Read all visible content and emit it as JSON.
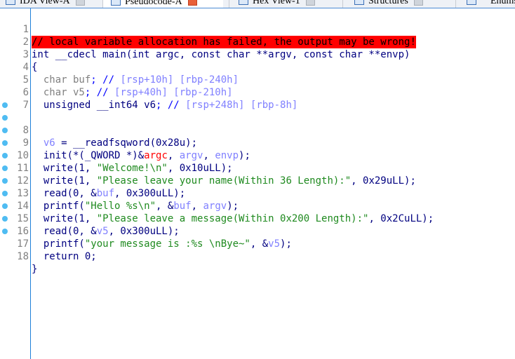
{
  "tabs": [
    {
      "label": "IDA View-A",
      "active": false
    },
    {
      "label": "Pseudocode-A",
      "active": true
    },
    {
      "label": "Hex View-1",
      "active": false
    },
    {
      "label": "Structures",
      "active": false
    },
    {
      "label": "Enums",
      "active": false
    }
  ],
  "code": {
    "line_numbers": [
      "1",
      "2",
      "3",
      "4",
      "5",
      "6",
      "7",
      "8",
      "9",
      "10",
      "11",
      "12",
      "13",
      "14",
      "15",
      "16",
      "17",
      "18"
    ],
    "l1": "// local variable allocation has failed, the output may be wrong!",
    "l2": "int __cdecl main(int argc, const char **argv, const char **envp)",
    "l3": "{",
    "l4a": "  char buf",
    "l4b": "; // ",
    "l4c": "[rsp+10h] [rbp-240h]",
    "l5a": "  char v5",
    "l5b": "; // ",
    "l5c": "[rsp+40h] [rbp-210h]",
    "l6a": "  unsigned __int64 v6",
    "l6b": "; // ",
    "l6c": "[rsp+248h] [rbp-8h]",
    "l8a": "  ",
    "l8b": "v6",
    "l8c": " = __readfsqword(0x28u);",
    "l9a": "  init(*(_QWORD *)&",
    "l9b": "argc",
    "l9c": ", ",
    "l9d": "argv",
    "l9e": ", ",
    "l9f": "envp",
    "l9g": ");",
    "l10a": "  write(1, ",
    "l10b": "\"Welcome!\\n\"",
    "l10c": ", 0x10uLL);",
    "l11a": "  write(1, ",
    "l11b": "\"Please leave your name(Within 36 Length):\"",
    "l11c": ", 0x29uLL);",
    "l12a": "  read(0, &",
    "l12b": "buf",
    "l12c": ", 0x300uLL);",
    "l13a": "  printf(",
    "l13b": "\"Hello %s\\n\"",
    "l13c": ", &",
    "l13d": "buf",
    "l13e": ", ",
    "l13f": "argv",
    "l13g": ");",
    "l14a": "  write(1, ",
    "l14b": "\"Please leave a message(Within 0x200 Length):\"",
    "l14c": ", 0x2CuLL);",
    "l15a": "  read(0, &",
    "l15b": "v5",
    "l15c": ", 0x300uLL);",
    "l16a": "  printf(",
    "l16b": "\"your message is :%s \\nBye~\"",
    "l16c": ", &",
    "l16d": "v5",
    "l16e": ");",
    "l17": "  return 0;",
    "l18": "}"
  },
  "breakpoint_lines": [
    "8",
    "9",
    "10",
    "11",
    "12",
    "13",
    "14",
    "15",
    "16",
    "17",
    "18"
  ],
  "colors": {
    "warning_bg": "#ff0000",
    "keyword": "#000080",
    "string": "#1f8a1f",
    "comment": "#0000ff",
    "local_var": "#8080ff",
    "breakpoint_dot": "#4fbcf2",
    "gutter_border": "#1e7fd8"
  }
}
